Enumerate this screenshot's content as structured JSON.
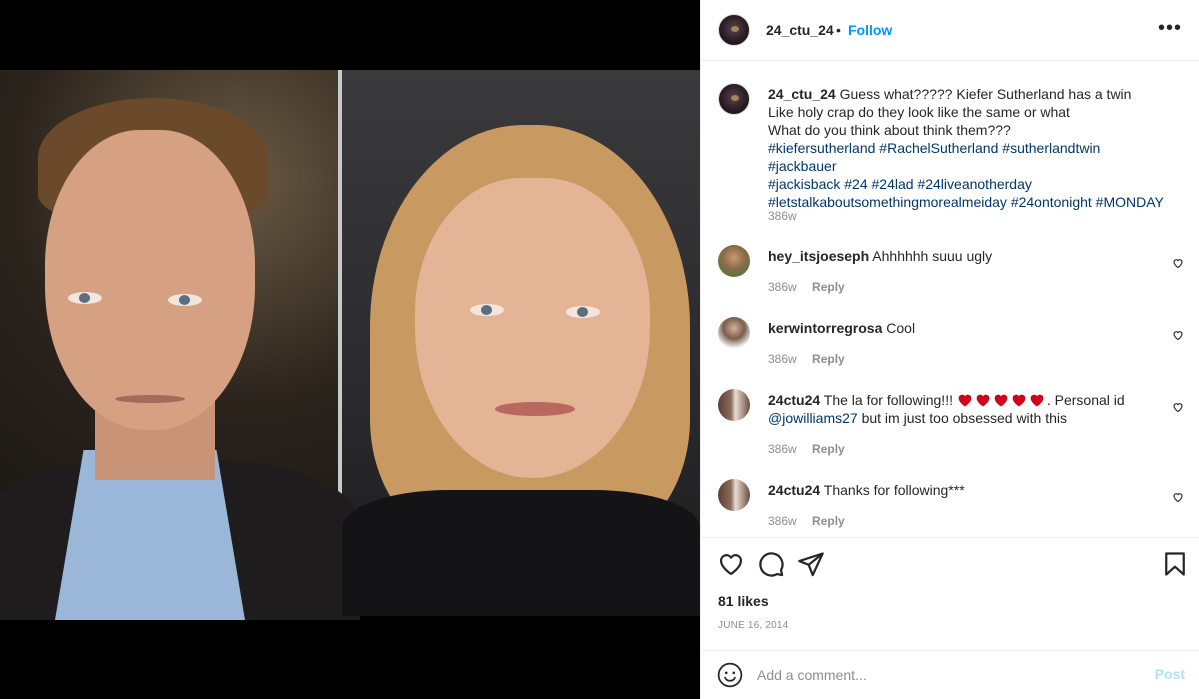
{
  "post": {
    "author": "24_ctu_24",
    "follow_label": "Follow",
    "separator": "•",
    "more_label": "•••",
    "caption": {
      "username": "24_ctu_24",
      "line1": "Guess what????? Kiefer Sutherland has a twin",
      "line2": "Like holy crap do they look like the same or what",
      "line3": "What do you think about think them???",
      "hashtags_line1": [
        "#kiefersutherland",
        "#RachelSutherland",
        "#sutherlandtwin",
        "#jackbauer"
      ],
      "hashtags_line2": [
        "#jackisback",
        "#24",
        "#24lad",
        "#24liveanotherday"
      ],
      "hashtags_line3": [
        "#letstalkaboutsomethingmorealmeiday",
        "#24ontonight",
        "#MONDAY"
      ],
      "age": "386w"
    },
    "comments": [
      {
        "username": "hey_itsjoeseph",
        "text": "Ahhhhhh suuu ugly",
        "age": "386w",
        "reply": "Reply"
      },
      {
        "username": "kerwintorregrosa",
        "text": "Cool",
        "age": "386w",
        "reply": "Reply"
      },
      {
        "username": "24ctu24",
        "text_before": "The la for following!!!",
        "text_after": ". Personal id",
        "mention": "@jowilliams27",
        "text_end": "but im just too obsessed with this",
        "age": "386w",
        "reply": "Reply"
      },
      {
        "username": "24ctu24",
        "text": "Thanks for following***",
        "age": "386w",
        "reply": "Reply"
      }
    ],
    "likes": "81 likes",
    "date": "JUNE 16, 2014",
    "add_comment_placeholder": "Add a comment...",
    "post_label": "Post"
  },
  "colors": {
    "link": "#00376b",
    "follow": "#0095f6",
    "muted": "#8e8e8e",
    "post_disabled": "#b2dffc",
    "emoji_heart": "#d0021b"
  },
  "icons": [
    "more-options-icon",
    "like-icon",
    "comment-icon",
    "share-icon",
    "save-icon",
    "emoji-icon",
    "heart-small-icon",
    "red-heart-emoji-icon"
  ]
}
